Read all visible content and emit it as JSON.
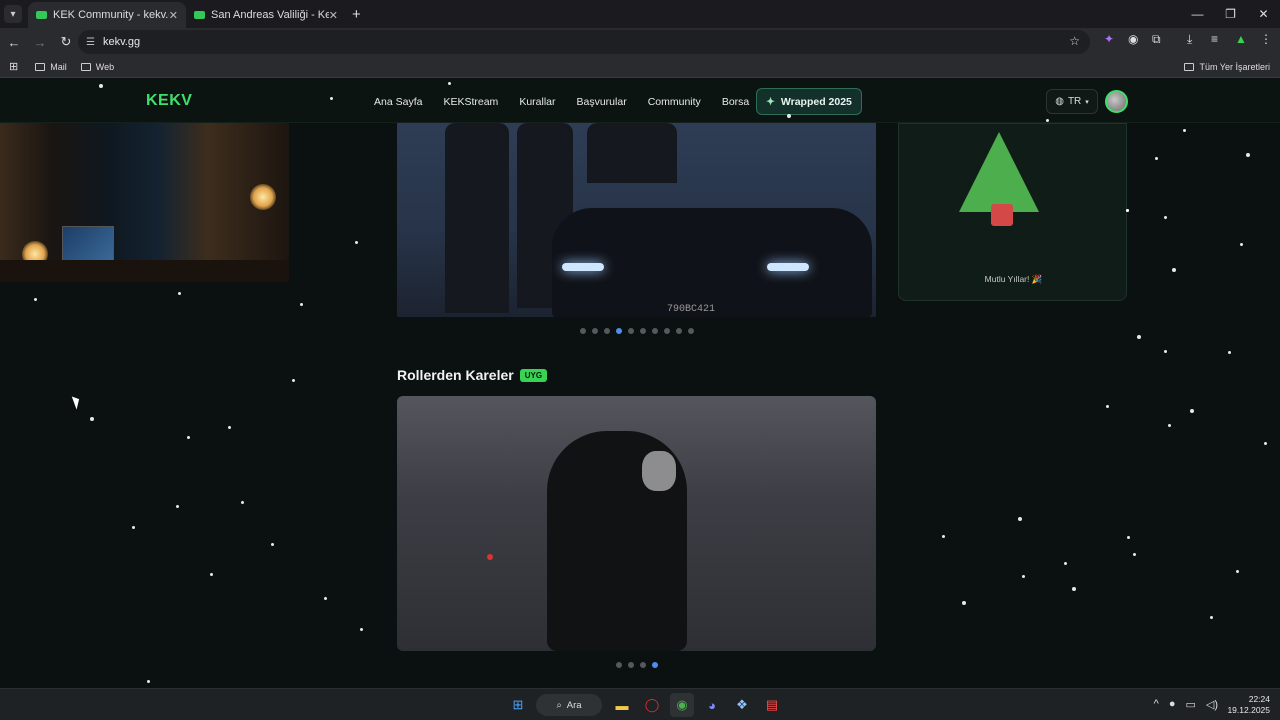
{
  "browser": {
    "tabs": [
      {
        "title": "KEK Community - kekv.gg",
        "active": true
      },
      {
        "title": "San Andreas Valiliği - Kekpedia",
        "active": false
      }
    ],
    "url": "kekv.gg",
    "bookmarks": [
      "Mail",
      "Web"
    ],
    "all_bookmarks": "Tüm Yer İşaretleri"
  },
  "site": {
    "logo": "KEKV",
    "nav": [
      "Ana Sayfa",
      "KEKStream",
      "Kurallar",
      "Başvurular",
      "Community",
      "Borsa"
    ],
    "wrapped_label": "Wrapped 2025",
    "lang": "TR",
    "accent": "#3fe06a"
  },
  "holiday_card": {
    "message": "Mutlu Yıllar! 🎉"
  },
  "carousel1": {
    "plate": "790BC421",
    "total_slides": 10,
    "active_slide": 4
  },
  "section": {
    "title": "Rollerden Kareler",
    "badge": "UYG"
  },
  "carousel2": {
    "total_slides": 4,
    "active_slide": 4
  },
  "taskbar": {
    "search_label": "Ara",
    "time": "22:24",
    "date": "19.12.2025"
  }
}
